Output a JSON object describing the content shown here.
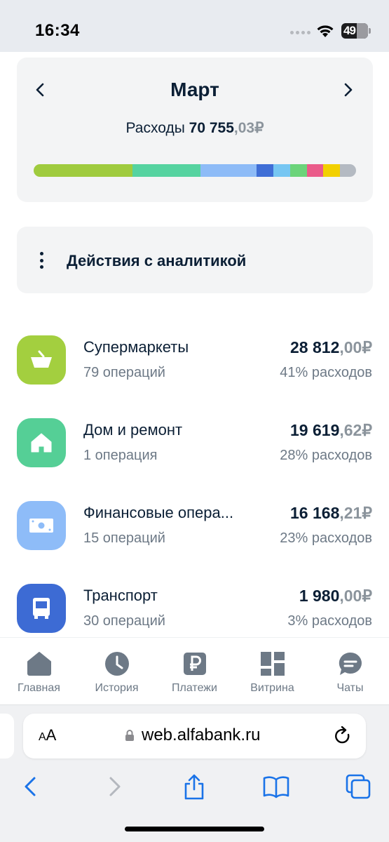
{
  "status_bar": {
    "time": "16:34",
    "battery": "49",
    "icons": [
      "signal-dots",
      "wifi-icon",
      "battery-icon"
    ]
  },
  "month_card": {
    "title": "Март",
    "expense_label": "Расходы",
    "expense_int": "70 755",
    "expense_frac": ",03",
    "currency": "₽",
    "prev_icon": "chevron-left-icon",
    "next_icon": "chevron-right-icon",
    "bar_segments": [
      {
        "share": 30.7,
        "color": "#9fcb3e"
      },
      {
        "share": 21,
        "color": "#55d3a0"
      },
      {
        "share": 17.4,
        "color": "#8dbbf7"
      },
      {
        "share": 5.2,
        "color": "#3f6ed6"
      },
      {
        "share": 5.2,
        "color": "#76c6f2"
      },
      {
        "share": 5.2,
        "color": "#6bd47a"
      },
      {
        "share": 5.2,
        "color": "#ea5b8a"
      },
      {
        "share": 5.2,
        "color": "#f2d000"
      },
      {
        "share": 4.9,
        "color": "#b4bac2"
      }
    ]
  },
  "analytics": {
    "label": "Действия с аналитикой",
    "icon": "kebab-icon"
  },
  "categories": [
    {
      "name": "Супермаркеты",
      "count": "79 операций",
      "amount_int": "28 812",
      "amount_frac": ",00",
      "currency": "₽",
      "share": "41% расходов",
      "icon": "basket-icon",
      "color": "#a3cf3f"
    },
    {
      "name": "Дом и ремонт",
      "count": "1 операция",
      "amount_int": "19 619",
      "amount_frac": ",62",
      "currency": "₽",
      "share": "28% расходов",
      "icon": "house-icon",
      "color": "#55cf96"
    },
    {
      "name": "Финансовые опера...",
      "count": "15 операций",
      "amount_int": "16 168",
      "amount_frac": ",21",
      "currency": "₽",
      "share": "23% расходов",
      "icon": "banknote-icon",
      "color": "#8ebcf8"
    },
    {
      "name": "Транспорт",
      "count": "30 операций",
      "amount_int": "1 980",
      "amount_frac": ",00",
      "currency": "₽",
      "share": "3% расходов",
      "icon": "bus-icon",
      "color": "#3d6bd4"
    }
  ],
  "tabs": [
    {
      "label": "Главная",
      "icon": "home-icon"
    },
    {
      "label": "История",
      "icon": "clock-icon"
    },
    {
      "label": "Платежи",
      "icon": "ruble-icon"
    },
    {
      "label": "Витрина",
      "icon": "grid-icon"
    },
    {
      "label": "Чаты",
      "icon": "chat-icon"
    }
  ],
  "browser": {
    "aa_small": "A",
    "aa_big": "A",
    "url": "web.alfabank.ru",
    "icons": [
      "lock-icon",
      "reload-icon",
      "back-icon",
      "forward-icon",
      "share-icon",
      "bookmarks-icon",
      "tabs-icon"
    ]
  }
}
